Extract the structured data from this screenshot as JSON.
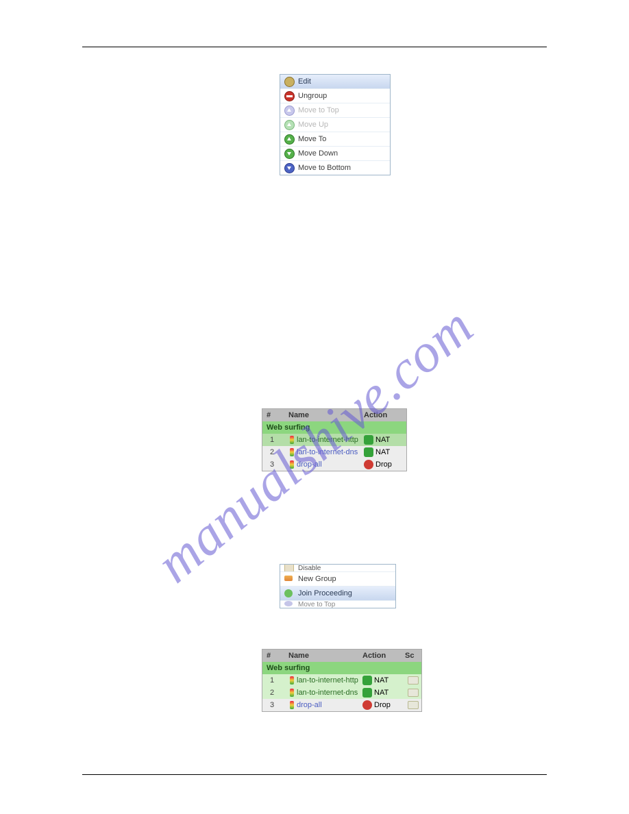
{
  "hr": {},
  "watermark": "manualshive.com",
  "ctx1": {
    "items": [
      {
        "label": "Edit",
        "iconClass": "ico-edit",
        "sel": true
      },
      {
        "label": "Ungroup",
        "iconClass": "ico-stop"
      },
      {
        "label": "Move to Top",
        "iconClass": "ico-up-m",
        "disabled": true
      },
      {
        "label": "Move Up",
        "iconClass": "ico-up-g",
        "disabled": true
      },
      {
        "label": "Move To",
        "iconClass": "ico-arrow-green right"
      },
      {
        "label": "Move Down",
        "iconClass": "ico-arrow-green down"
      },
      {
        "label": "Move to Bottom",
        "iconClass": "ico-arrow-blue"
      }
    ]
  },
  "tbl1": {
    "headers": {
      "num": "#",
      "name": "Name",
      "action": "Action"
    },
    "group": "Web surfing",
    "rows": [
      {
        "n": "1",
        "name": "lan-to-internet-http",
        "actText": "NAT",
        "act": "nat",
        "cls": "lightg sel",
        "link": "greenlink"
      },
      {
        "n": "2",
        "name": "lan-to-internet-dns",
        "actText": "NAT",
        "act": "nat",
        "cls": "eee",
        "link": "link"
      },
      {
        "n": "3",
        "name": "drop-all",
        "actText": "Drop",
        "act": "drop",
        "cls": "eee",
        "link": "link"
      }
    ]
  },
  "ctx2": {
    "top_cut": "Disable",
    "items": [
      {
        "label": "New Group",
        "ico": "grp-ico"
      },
      {
        "label": "Join Proceeding",
        "ico": "join-ico",
        "sel": true
      }
    ],
    "bot_cut": "Move to Top"
  },
  "tbl2": {
    "headers": {
      "num": "#",
      "name": "Name",
      "action": "Action",
      "sc": "Sc"
    },
    "group": "Web surfing",
    "rows": [
      {
        "n": "1",
        "name": "lan-to-internet-http",
        "actText": "NAT",
        "act": "nat",
        "cls": "lightg",
        "link": "greenlink"
      },
      {
        "n": "2",
        "name": "lan-to-internet-dns",
        "actText": "NAT",
        "act": "nat",
        "cls": "lightg",
        "link": "greenlink"
      },
      {
        "n": "3",
        "name": "drop-all",
        "actText": "Drop",
        "act": "drop",
        "cls": "eee",
        "link": "link"
      }
    ]
  }
}
